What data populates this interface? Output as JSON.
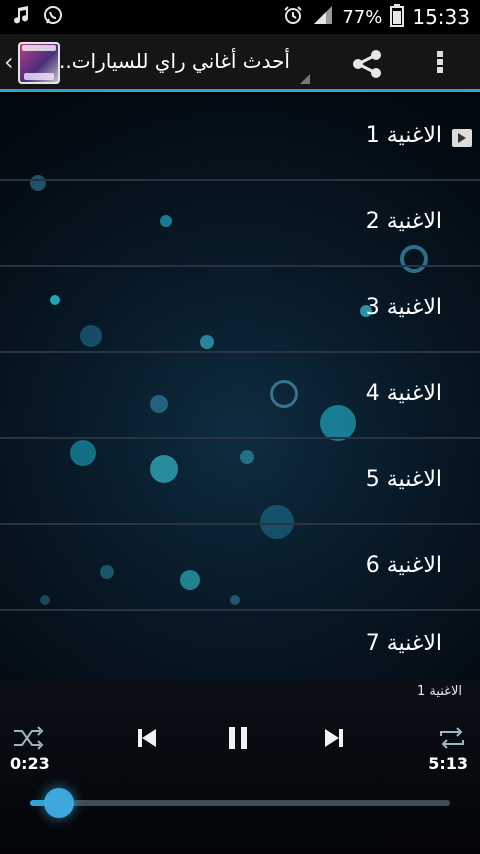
{
  "status_bar": {
    "battery": "77%",
    "time": "15:33"
  },
  "header": {
    "title": "أحدث أغاني راي للسيارات.."
  },
  "songs": {
    "items": [
      {
        "label": "الاغنية 1"
      },
      {
        "label": "الاغنية 2"
      },
      {
        "label": "الاغنية 3"
      },
      {
        "label": "الاغنية 4"
      },
      {
        "label": "الاغنية 5"
      },
      {
        "label": "الاغنية 6"
      },
      {
        "label": "الاغنية 7"
      }
    ]
  },
  "player": {
    "now_playing": "الاغنية 1",
    "elapsed": "0:23",
    "duration": "5:13",
    "progress_fraction": 0.07
  },
  "colors": {
    "accent": "#2fa3d6"
  },
  "icons": [
    "music-note-icon",
    "whatsapp-icon",
    "alarm-icon",
    "signal-icon",
    "battery-icon",
    "back-chevron-icon",
    "share-icon",
    "overflow-menu-icon",
    "play-icon",
    "shuffle-icon",
    "previous-icon",
    "pause-icon",
    "next-icon",
    "repeat-icon"
  ]
}
